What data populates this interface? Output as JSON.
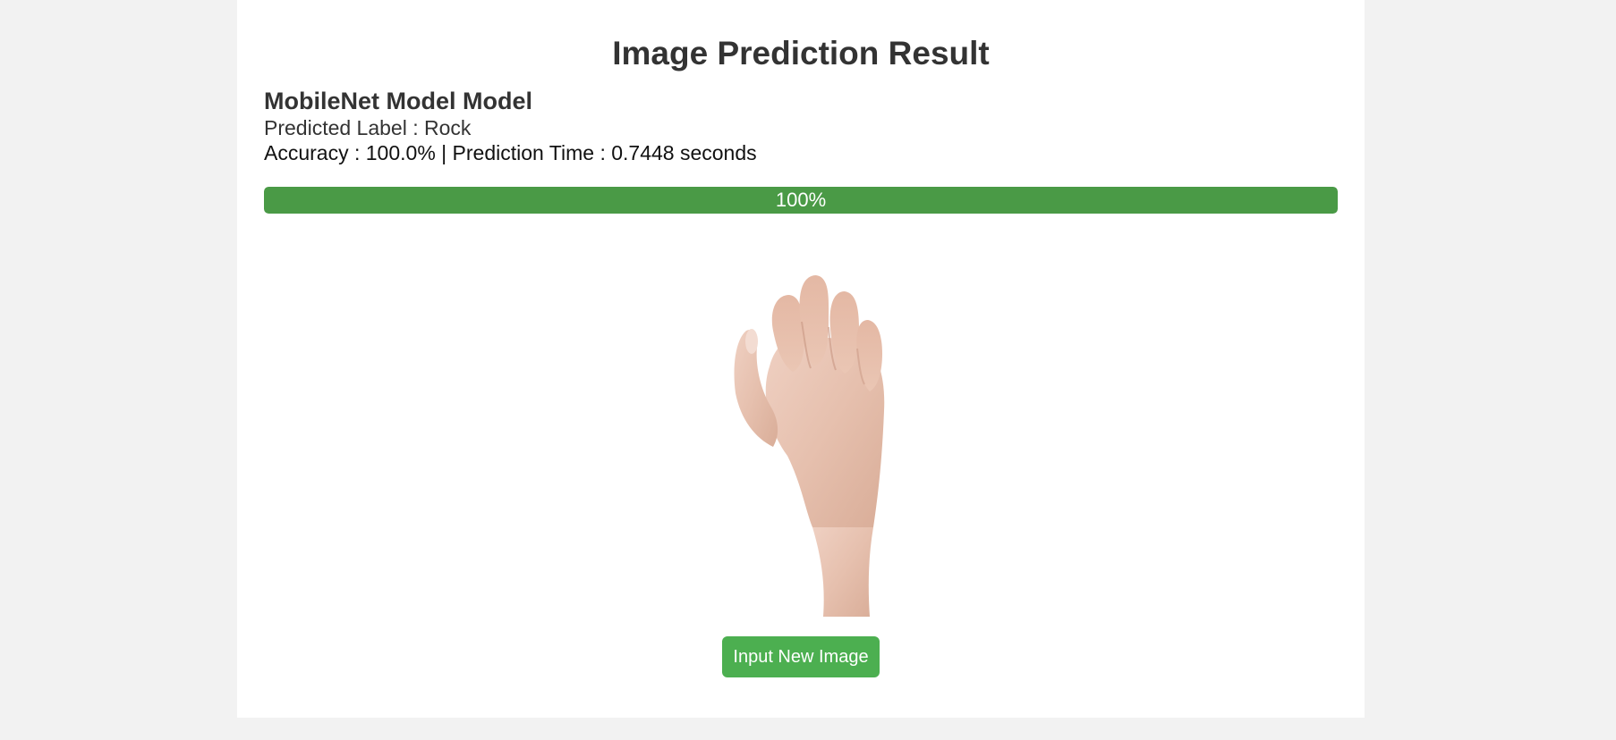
{
  "page": {
    "title": "Image Prediction Result"
  },
  "result": {
    "model_name": "MobileNet Model Model",
    "predicted_label_prefix": "Predicted Label : ",
    "predicted_label": "Rock",
    "accuracy_prefix": "Accuracy : ",
    "accuracy": "100.0%",
    "separator": " | ",
    "prediction_time_prefix": "Prediction Time : ",
    "prediction_time": "0.7448 seconds"
  },
  "progress": {
    "label": "100%",
    "percent": 100,
    "fill_color": "#4a9a46"
  },
  "image": {
    "subject": "hand-rock-gesture-photo"
  },
  "actions": {
    "input_new_image_label": "Input New Image"
  },
  "colors": {
    "background": "#f2f2f2",
    "card": "#ffffff",
    "accent": "#4caf50",
    "text": "#333333"
  }
}
